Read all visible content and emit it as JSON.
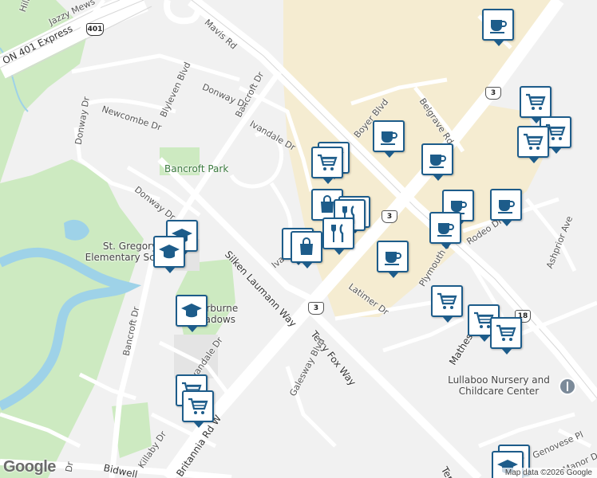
{
  "map": {
    "roads": {
      "highway": "ON 401 Express",
      "mavis": "Mavis Rd",
      "jazzy": "Jazzy Mews",
      "bancroft_top": "Bancroft Dr",
      "bancroft_bottom": "Bancroft Dr",
      "donway_top": "Donway Dr",
      "donway_left": "Donway Dr",
      "donway_mid": "Donway Dr",
      "newcombe": "Newcombe Dr",
      "blyleven": "Blyleven Blvd",
      "ivandale_top": "Ivandale Dr",
      "ivandale_mid": "Ivandale Dr",
      "ivandale_bottom": "Ivandale Dr",
      "boyer": "Boyer Blvd",
      "belgrave": "Belgrave Rd",
      "silken": "Silken Laumann Way",
      "terryfox": "Terry Fox Way",
      "terry_bottom": "Terry",
      "galesway": "Galesway Blvd",
      "latimer": "Latimer Dr",
      "plymouth": "Plymouth Dr",
      "rodeo": "Rodeo Dr",
      "ashprior": "Ashprior Ave",
      "matheson": "Matheson",
      "britannia": "Britannia Rd W",
      "bidwell": "Bidwell",
      "killaby": "Killaby Dr",
      "genovese": "Genovese Pl",
      "manor": "Manor Dr",
      "left_bottom": "Dr",
      "top_left": "Hill"
    },
    "shields": {
      "s401": "401",
      "s3a": "3",
      "s3b": "3",
      "s3c": "3",
      "s18": "18"
    },
    "places": {
      "park": "Bancroft Park",
      "school1": "St. Gregory Elementary School",
      "school2": "Sherburne Meadows",
      "nursery": "Lullaboo Nursery and Childcare Center"
    },
    "attribution": "Map data ©2026 Google",
    "logo": "Google"
  },
  "colors": {
    "marker": "#1d5c8a",
    "commercial": "#f5ecd1",
    "park": "#cdeac1",
    "water": "#9ed2e8",
    "road": "#ffffff"
  }
}
